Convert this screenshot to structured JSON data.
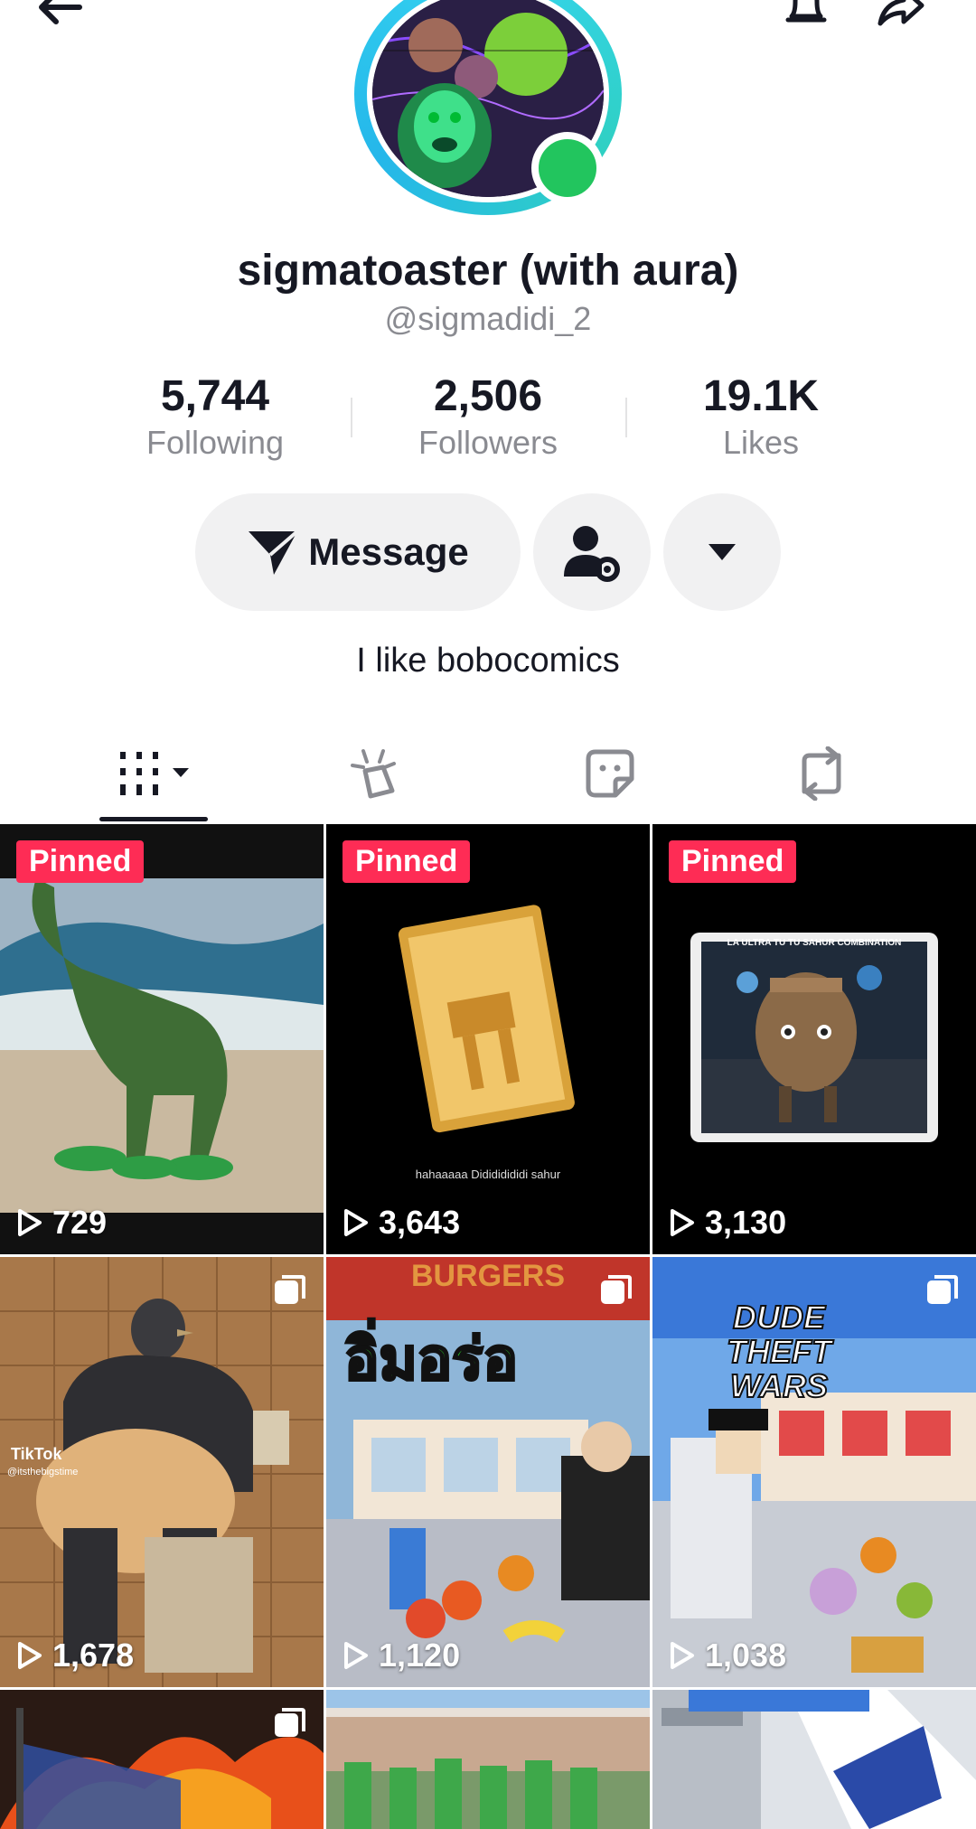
{
  "profile": {
    "display_name": "sigmatoaster (with aura)",
    "handle": "@sigmadidi_2",
    "bio": "I like bobocomics"
  },
  "stats": [
    {
      "value": "5,744",
      "label": "Following"
    },
    {
      "value": "2,506",
      "label": "Followers"
    },
    {
      "value": "19.1K",
      "label": "Likes"
    }
  ],
  "actions": {
    "message_label": "Message"
  },
  "tabs": [
    {
      "icon": "grid-icon"
    },
    {
      "icon": "reposts-sparkle-icon"
    },
    {
      "icon": "favorites-sticker-icon"
    },
    {
      "icon": "repost-icon"
    }
  ],
  "videos": [
    {
      "pinned": "Pinned",
      "views": "729"
    },
    {
      "pinned": "Pinned",
      "views": "3,643",
      "caption": "hahaaaaa Didididididi sahur"
    },
    {
      "pinned": "Pinned",
      "views": "3,130",
      "caption": "LA ULTRA TU TU SAHUR COMBINATION"
    },
    {
      "views": "1,678",
      "watermark": "TikTok",
      "watermark_handle": "@itsthebigstime"
    },
    {
      "views": "1,120",
      "overlay_text": "อิ่มอร่อ",
      "sign_text": "BURGERS"
    },
    {
      "views": "1,038",
      "overlay_text": "DUDE THEFT WARS"
    },
    {},
    {},
    {}
  ],
  "colors": {
    "accent_pink": "#fe2c55",
    "ring_cyan": "#35d4f0",
    "online_green": "#22c55e"
  }
}
